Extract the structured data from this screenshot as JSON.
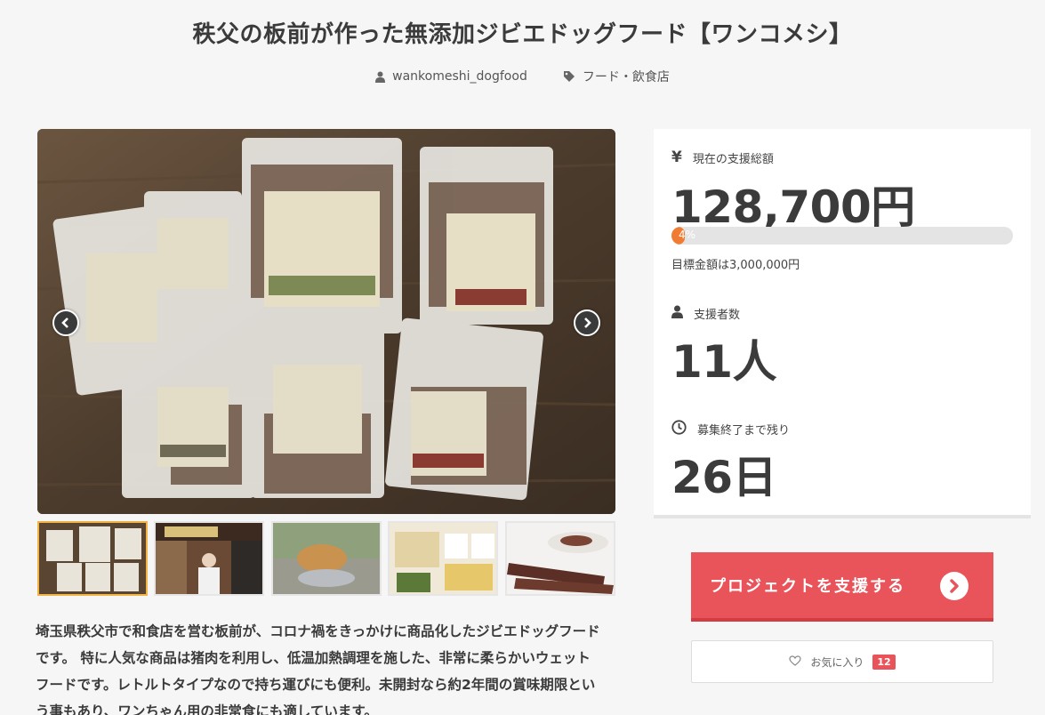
{
  "project": {
    "title": "秩父の板前が作った無添加ジビエドッグフード【ワンコメシ】",
    "author": "wankomeshi_dogfood",
    "category": "フード・飲食店",
    "description_lines": [
      "埼玉県秩父市で和食店を営む板前が、コロナ禍をきっかけに商品化したジビエドッグフード",
      "です。 特に人気な商品は猪肉を利用し、低温加熱調理を施した、非常に柔らかいウェット",
      "フードです。レトルトタイプなので持ち運びにも便利。未開封なら約2年間の賞味期限とい",
      "う事もあり、ワンちゃん用の非常食にも適しています。"
    ]
  },
  "stats": {
    "total_label": "現在の支援総額",
    "currency_symbol": "¥",
    "total_value": "128,700円",
    "progress_percent": 4,
    "progress_text": "4%",
    "goal_text": "目標金額は3,000,000円",
    "backers_label": "支援者数",
    "backers_value": "11人",
    "remaining_label": "募集終了まで残り",
    "remaining_value": "26日"
  },
  "actions": {
    "support_label": "プロジェクトを支援する",
    "favorite_label": "お気に入り",
    "favorite_count": "12"
  },
  "gallery": {
    "active_index": 0,
    "thumbnails": [
      "thumb-products",
      "thumb-chef-storefront",
      "thumb-dog-eating",
      "thumb-product-card",
      "thumb-jerky"
    ]
  },
  "colors": {
    "accent_red": "#e9545a",
    "progress_orange": "#f07c33",
    "active_thumb_border": "#f2b544"
  }
}
